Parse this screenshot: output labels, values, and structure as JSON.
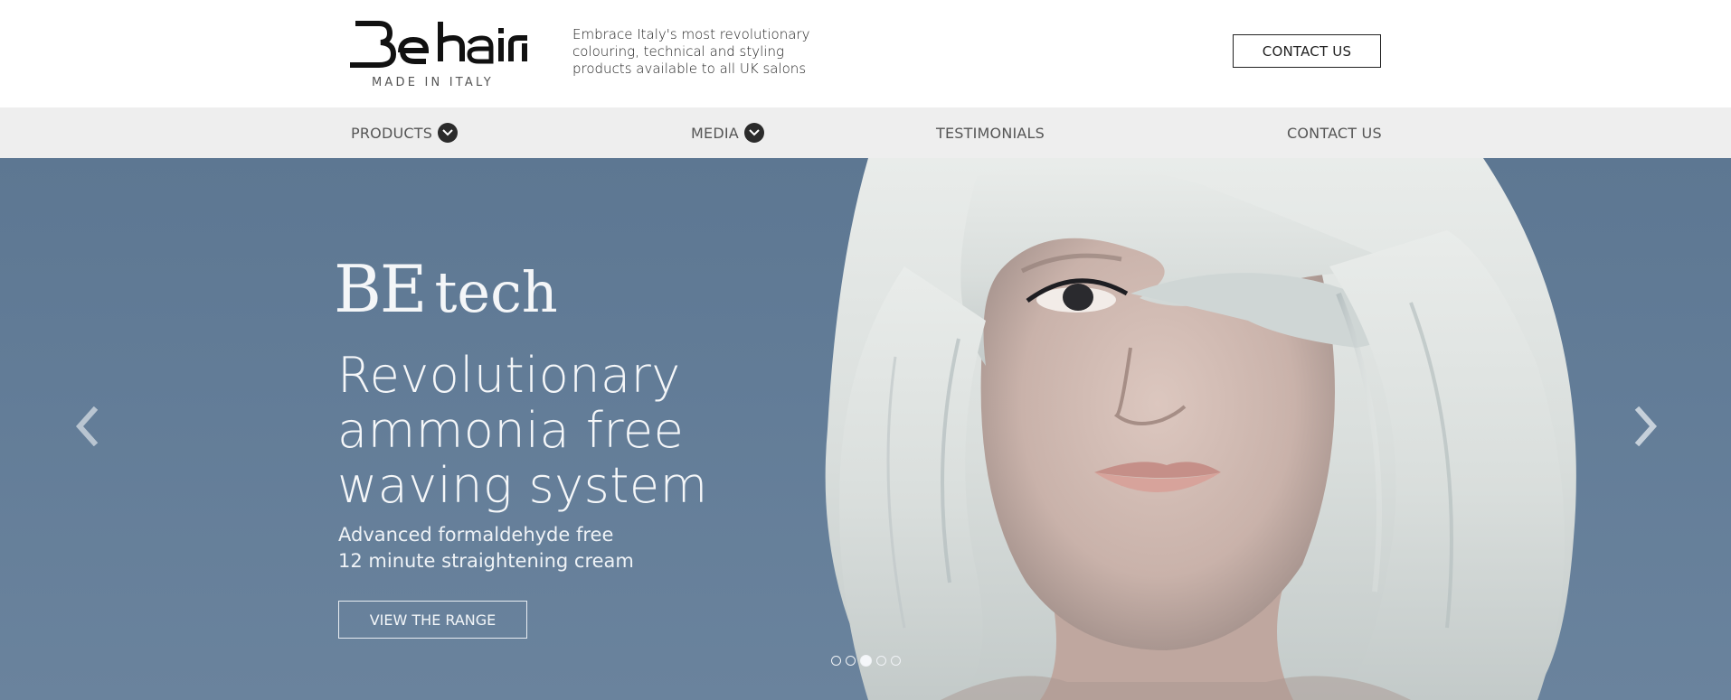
{
  "header": {
    "logo_text": "Be hair",
    "logo_subtext": "MADE IN ITALY",
    "tagline": [
      "Embrace Italy's most revolutionary",
      "colouring, technical and styling",
      "products available to all UK salons"
    ],
    "contact_button": "CONTACT US"
  },
  "nav": {
    "items": [
      {
        "label": "PRODUCTS",
        "has_dropdown": true
      },
      {
        "label": "MEDIA",
        "has_dropdown": true
      },
      {
        "label": "TESTIMONIALS",
        "has_dropdown": false
      },
      {
        "label": "CONTACT US",
        "has_dropdown": false
      }
    ]
  },
  "hero": {
    "brand_logo": {
      "be": "BE",
      "tech": "tech"
    },
    "headline": [
      "Revolutionary",
      "ammonia free",
      "waving system"
    ],
    "subline": [
      "Advanced formaldehyde free",
      "12 minute straightening cream"
    ],
    "cta_label": "VIEW THE RANGE",
    "slides": {
      "count": 5,
      "active_index": 2
    }
  },
  "colors": {
    "nav_bg": "#eeeeee",
    "hero_bg": "#627c97",
    "hero_text": "#f5f7f9",
    "dark": "#2b2b2b"
  }
}
